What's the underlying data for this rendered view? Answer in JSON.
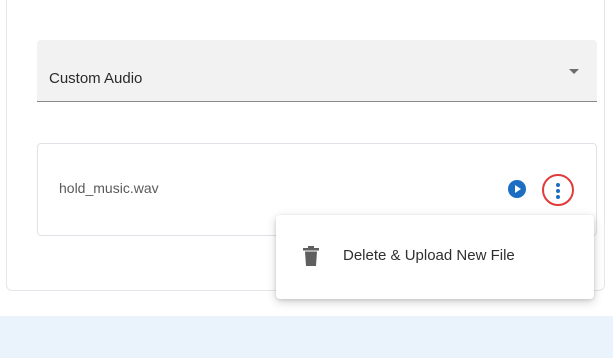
{
  "audio_select": {
    "value": "Custom Audio"
  },
  "file": {
    "name": "hold_music.wav"
  },
  "menu": {
    "items": [
      {
        "label": "Delete & Upload New File",
        "icon": "trash-icon"
      }
    ]
  },
  "colors": {
    "accent": "#1b6ec2",
    "highlight_ring": "#e03a3a",
    "select_bg": "#f2f2f2",
    "bottom_band": "#eaf3fc"
  }
}
